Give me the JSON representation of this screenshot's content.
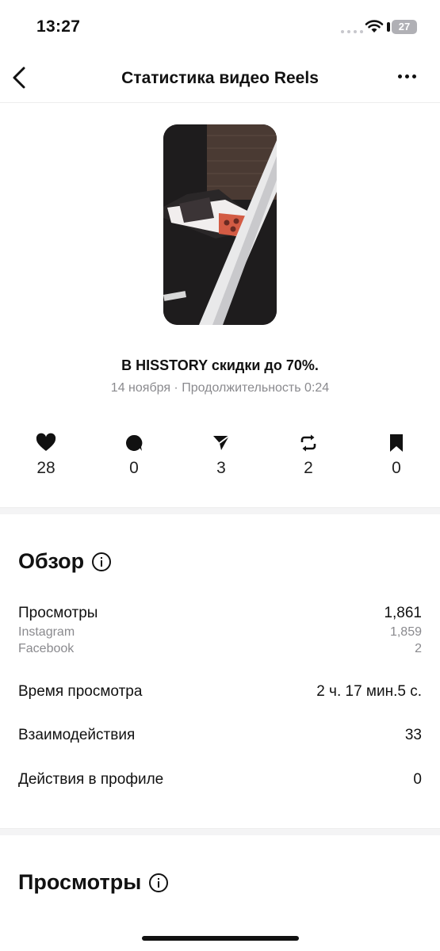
{
  "status_bar": {
    "time": "13:27",
    "battery": "27"
  },
  "nav": {
    "title": "Статистика видео Reels"
  },
  "post": {
    "caption": "В HISSTORY скидки до 70%.",
    "date": "14 ноября",
    "duration_label": "Продолжительность 0:24"
  },
  "stats": {
    "likes": "28",
    "comments": "0",
    "shares": "3",
    "reposts": "2",
    "saves": "0"
  },
  "overview": {
    "title": "Обзор",
    "rows": {
      "views": {
        "label": "Просмотры",
        "value": "1,861"
      },
      "instagram": {
        "label": "Instagram",
        "value": "1,859"
      },
      "facebook": {
        "label": "Facebook",
        "value": "2"
      },
      "watch_time": {
        "label": "Время просмотра",
        "value": "2 ч. 17 мин.5 с."
      },
      "interactions": {
        "label": "Взаимодействия",
        "value": "33"
      },
      "profile_actions": {
        "label": "Действия в профиле",
        "value": "0"
      }
    }
  },
  "views_section": {
    "title": "Просмотры"
  },
  "colors": {
    "text": "#111111",
    "secondary": "#8a8a8e",
    "separator": "#f4f4f5"
  }
}
